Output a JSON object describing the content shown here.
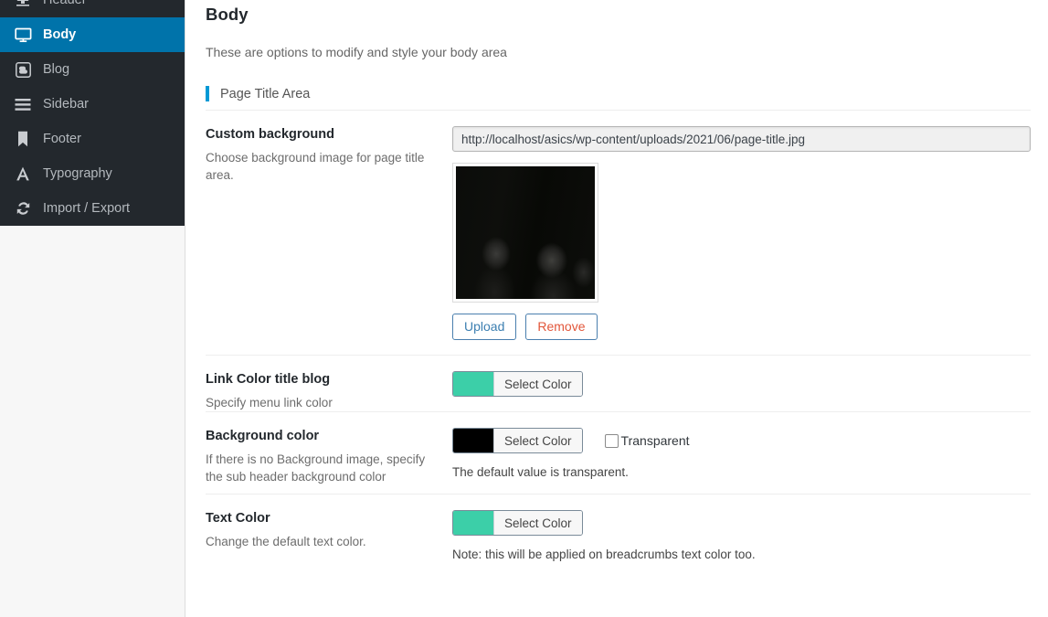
{
  "sidebar": {
    "items": [
      {
        "label": "Header",
        "icon": "header-icon",
        "active": false,
        "partial": true
      },
      {
        "label": "Body",
        "icon": "monitor-icon",
        "active": true,
        "partial": false
      },
      {
        "label": "Blog",
        "icon": "blogger-b-icon",
        "active": false,
        "partial": false
      },
      {
        "label": "Sidebar",
        "icon": "hamburger-lines-icon",
        "active": false,
        "partial": false
      },
      {
        "label": "Footer",
        "icon": "bookmark-icon",
        "active": false,
        "partial": false
      },
      {
        "label": "Typography",
        "icon": "letter-a-icon",
        "active": false,
        "partial": false
      },
      {
        "label": "Import / Export",
        "icon": "sync-refresh-icon",
        "active": false,
        "partial": false
      }
    ],
    "active_color": "#0073aa",
    "background_color": "#23282d"
  },
  "main": {
    "title": "Body",
    "description": "These are options to modify and style your body area",
    "section": {
      "title": "Page Title Area",
      "accent_color": "#0099d5"
    },
    "fields": {
      "custom_background": {
        "label": "Custom background",
        "hint": "Choose background image for page title area.",
        "url_value": "http://localhost/asics/wp-content/uploads/2021/06/page-title.jpg",
        "upload_label": "Upload",
        "remove_label": "Remove"
      },
      "link_color": {
        "label": "Link Color title blog",
        "hint": "Specify menu link color",
        "select_color_label": "Select Color",
        "swatch_color": "#3ccfa8"
      },
      "background_color": {
        "label": "Background color",
        "hint": "If there is no Background image, specify the sub header background color",
        "select_color_label": "Select Color",
        "swatch_color": "#000000",
        "transparent_label": "Transparent",
        "transparent_checked": false,
        "note": "The default value is transparent."
      },
      "text_color": {
        "label": "Text Color",
        "hint": "Change the default text color.",
        "select_color_label": "Select Color",
        "swatch_color": "#3ccfa8",
        "note": "Note: this will be applied on breadcrumbs text color too."
      }
    }
  }
}
